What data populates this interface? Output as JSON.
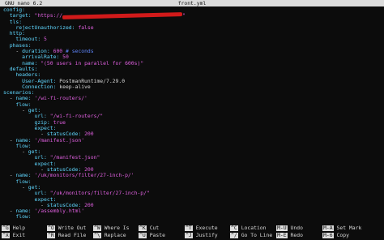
{
  "titlebar": {
    "version": "GNU nano 6.2",
    "filename": "front.yml"
  },
  "editor": {
    "lines": [
      [
        [
          "k",
          "config:"
        ]
      ],
      [
        [
          "p",
          "  "
        ],
        [
          "k",
          "target:"
        ],
        [
          "p",
          " "
        ],
        [
          "s",
          "\"https://"
        ],
        [
          "redact",
          ""
        ],
        [
          "s",
          "\""
        ]
      ],
      [
        [
          "p",
          "  "
        ],
        [
          "k",
          "tls:"
        ]
      ],
      [
        [
          "p",
          "    "
        ],
        [
          "k",
          "rejectUnauthorized:"
        ],
        [
          "p",
          " "
        ],
        [
          "b",
          "false"
        ]
      ],
      [
        [
          "p",
          "  "
        ],
        [
          "k",
          "http:"
        ]
      ],
      [
        [
          "p",
          "    "
        ],
        [
          "k",
          "timeout:"
        ],
        [
          "p",
          " "
        ],
        [
          "n",
          "5"
        ]
      ],
      [
        [
          "p",
          "  "
        ],
        [
          "k",
          "phases:"
        ]
      ],
      [
        [
          "p",
          "    - "
        ],
        [
          "k",
          "duration:"
        ],
        [
          "p",
          " "
        ],
        [
          "n",
          "600"
        ],
        [
          "p",
          " "
        ],
        [
          "c",
          "# seconds"
        ]
      ],
      [
        [
          "p",
          "      "
        ],
        [
          "k",
          "arrivalRate:"
        ],
        [
          "p",
          " "
        ],
        [
          "n",
          "50"
        ]
      ],
      [
        [
          "p",
          "      "
        ],
        [
          "k",
          "name:"
        ],
        [
          "p",
          " "
        ],
        [
          "s",
          "\"(50 users in parallel for 600s)\""
        ]
      ],
      [
        [
          "p",
          "  "
        ],
        [
          "k",
          "defaults:"
        ]
      ],
      [
        [
          "p",
          "    "
        ],
        [
          "k",
          "headers:"
        ]
      ],
      [
        [
          "p",
          "      "
        ],
        [
          "k",
          "User-Agent:"
        ],
        [
          "p",
          " PostmanRuntime/7.29.0"
        ]
      ],
      [
        [
          "p",
          "      "
        ],
        [
          "k",
          "Connection:"
        ],
        [
          "p",
          " keep-alive"
        ]
      ],
      [
        [
          "k",
          "scenarios:"
        ]
      ],
      [
        [
          "p",
          "  - "
        ],
        [
          "k",
          "name:"
        ],
        [
          "p",
          " "
        ],
        [
          "s",
          "'/wi-fi-routers/'"
        ]
      ],
      [
        [
          "p",
          "    "
        ],
        [
          "k",
          "flow:"
        ]
      ],
      [
        [
          "p",
          "      - "
        ],
        [
          "k",
          "get:"
        ]
      ],
      [
        [
          "p",
          "          "
        ],
        [
          "k",
          "url:"
        ],
        [
          "p",
          " "
        ],
        [
          "s",
          "\"/wi-fi-routers/\""
        ]
      ],
      [
        [
          "p",
          "          "
        ],
        [
          "k",
          "gzip:"
        ],
        [
          "p",
          " "
        ],
        [
          "b",
          "true"
        ]
      ],
      [
        [
          "p",
          "          "
        ],
        [
          "k",
          "expect:"
        ]
      ],
      [
        [
          "p",
          "            - "
        ],
        [
          "k",
          "statusCode:"
        ],
        [
          "p",
          " "
        ],
        [
          "n",
          "200"
        ]
      ],
      [
        [
          "p",
          "  - "
        ],
        [
          "k",
          "name:"
        ],
        [
          "p",
          " "
        ],
        [
          "s",
          "'/manifest.json'"
        ]
      ],
      [
        [
          "p",
          "    "
        ],
        [
          "k",
          "flow:"
        ]
      ],
      [
        [
          "p",
          "      - "
        ],
        [
          "k",
          "get:"
        ]
      ],
      [
        [
          "p",
          "          "
        ],
        [
          "k",
          "url:"
        ],
        [
          "p",
          " "
        ],
        [
          "s",
          "\"/manifest.json\""
        ]
      ],
      [
        [
          "p",
          "          "
        ],
        [
          "k",
          "expect:"
        ]
      ],
      [
        [
          "p",
          "            - "
        ],
        [
          "k",
          "statusCode:"
        ],
        [
          "p",
          " "
        ],
        [
          "n",
          "200"
        ]
      ],
      [
        [
          "p",
          "  - "
        ],
        [
          "k",
          "name:"
        ],
        [
          "p",
          " "
        ],
        [
          "s",
          "'/uk/monitors/filter/27-inch-p/'"
        ]
      ],
      [
        [
          "p",
          "    "
        ],
        [
          "k",
          "flow:"
        ]
      ],
      [
        [
          "p",
          "      - "
        ],
        [
          "k",
          "get:"
        ]
      ],
      [
        [
          "p",
          "          "
        ],
        [
          "k",
          "url:"
        ],
        [
          "p",
          " "
        ],
        [
          "s",
          "\"/uk/monitors/filter/27-inch-p/\""
        ]
      ],
      [
        [
          "p",
          "          "
        ],
        [
          "k",
          "expect:"
        ]
      ],
      [
        [
          "p",
          "            - "
        ],
        [
          "k",
          "statusCode:"
        ],
        [
          "p",
          " "
        ],
        [
          "n",
          "200"
        ]
      ],
      [
        [
          "p",
          "  - "
        ],
        [
          "k",
          "name:"
        ],
        [
          "p",
          " "
        ],
        [
          "s",
          "'/assembly.html'"
        ]
      ],
      [
        [
          "p",
          "    "
        ],
        [
          "k",
          "flow:"
        ]
      ]
    ]
  },
  "shortcuts": [
    {
      "key": "^G",
      "label": "Help"
    },
    {
      "key": "^X",
      "label": "Exit"
    },
    {
      "key": "^O",
      "label": "Write Out"
    },
    {
      "key": "^R",
      "label": "Read File"
    },
    {
      "key": "^W",
      "label": "Where Is"
    },
    {
      "key": "^\\",
      "label": "Replace"
    },
    {
      "key": "^K",
      "label": "Cut"
    },
    {
      "key": "^U",
      "label": "Paste"
    },
    {
      "key": "^T",
      "label": "Execute"
    },
    {
      "key": "^J",
      "label": "Justify"
    },
    {
      "key": "^C",
      "label": "Location"
    },
    {
      "key": "^/",
      "label": "Go To Line"
    },
    {
      "key": "M-U",
      "label": "Undo"
    },
    {
      "key": "M-E",
      "label": "Redo"
    },
    {
      "key": "M-A",
      "label": "Set Mark"
    },
    {
      "key": "M-6",
      "label": "Copy"
    }
  ]
}
